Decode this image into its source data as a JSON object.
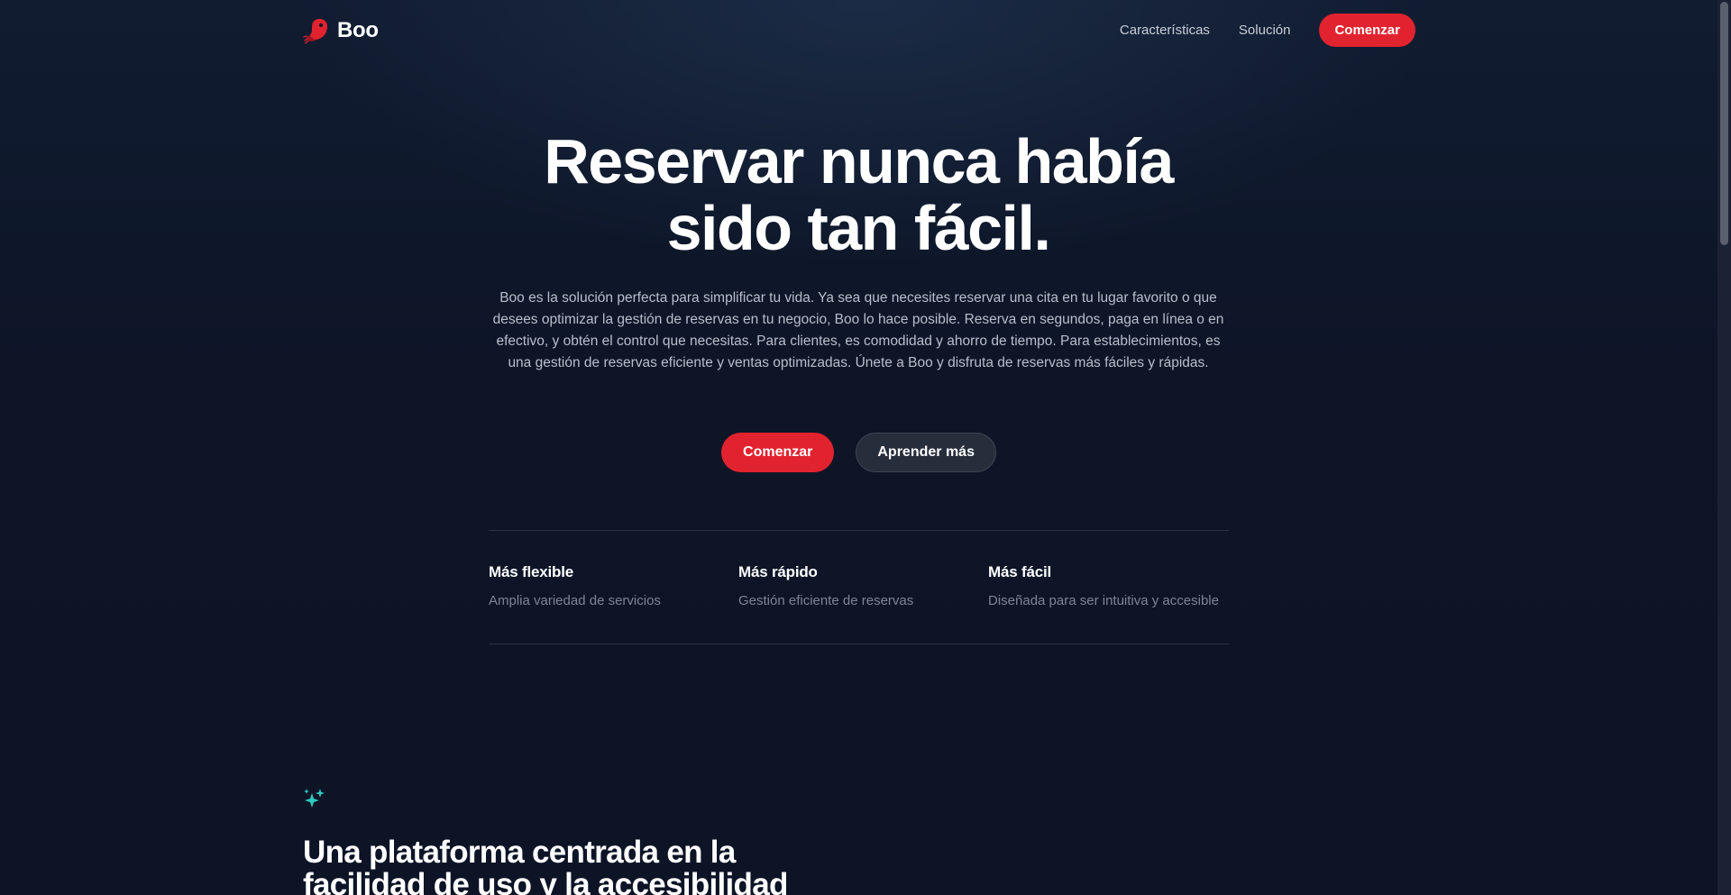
{
  "nav": {
    "brand": "Boo",
    "links": [
      "Características",
      "Solución"
    ],
    "cta": "Comenzar"
  },
  "hero": {
    "title_line1": "Reservar nunca había",
    "title_line2": "sido tan fácil.",
    "description": "Boo es la solución perfecta para simplificar tu vida. Ya sea que necesites reservar una cita en tu lugar favorito o que desees optimizar la gestión de reservas en tu negocio, Boo lo hace posible. Reserva en segundos, paga en línea o en efectivo, y obtén el control que necesitas. Para clientes, es comodidad y ahorro de tiempo. Para establecimientos, es una gestión de reservas eficiente y ventas optimizadas. Únete a Boo y disfruta de reservas más fáciles y rápidas.",
    "primary_button": "Comenzar",
    "secondary_button": "Aprender más"
  },
  "features": [
    {
      "title": "Más flexible",
      "description": "Amplia variedad de servicios"
    },
    {
      "title": "Más rápido",
      "description": "Gestión eficiente de reservas"
    },
    {
      "title": "Más fácil",
      "description": "Diseñada para ser intuitiva y accesible"
    }
  ],
  "section": {
    "icon": "sparkles-icon",
    "title": "Una plataforma centrada en la facilidad de uso y la accesibilidad"
  },
  "colors": {
    "background": "#0d1527",
    "accent": "#e1232f",
    "sparkle": "#2fc9c0",
    "muted_text": "#7d8595"
  }
}
